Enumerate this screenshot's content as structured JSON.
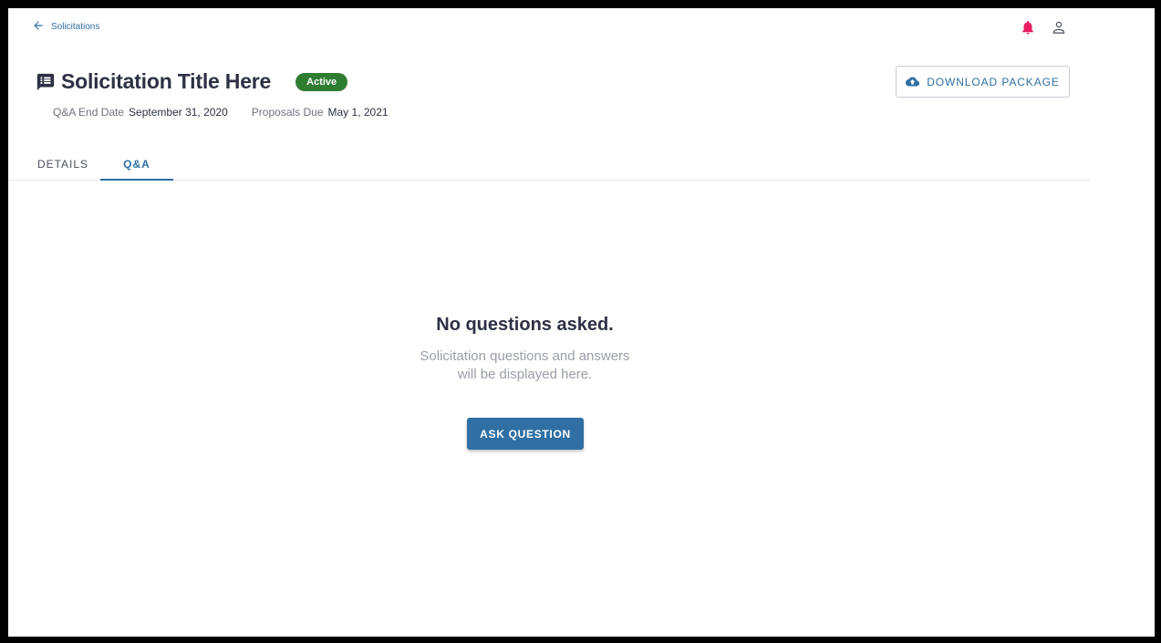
{
  "nav": {
    "back_label": "Solicitations",
    "back_icon": "arrow-left-icon",
    "notification_icon": "bell-icon",
    "user_icon": "user-icon",
    "notification_color": "#e91e63"
  },
  "header": {
    "icon": "message-list-icon",
    "title": "Solicitation Title Here",
    "status": "Active",
    "status_color": "#2e7d32",
    "qa_end_label": "Q&A End Date",
    "qa_end_value": "September 31, 2020",
    "proposals_label": "Proposals Due",
    "proposals_value": "May 1, 2021",
    "download_label": "DOWNLOAD PACKAGE",
    "download_icon": "cloud-upload-icon"
  },
  "tabs": [
    {
      "label": "DETAILS",
      "active": false
    },
    {
      "label": "Q&A",
      "active": true
    }
  ],
  "empty_state": {
    "title": "No questions asked.",
    "line1": "Solicitation questions and answers",
    "line2": "will be displayed here.",
    "button_label": "ASK QUESTION"
  },
  "colors": {
    "accent": "#2f6fa3",
    "title_text": "#2d3142",
    "muted_text": "#9a9ea8"
  }
}
